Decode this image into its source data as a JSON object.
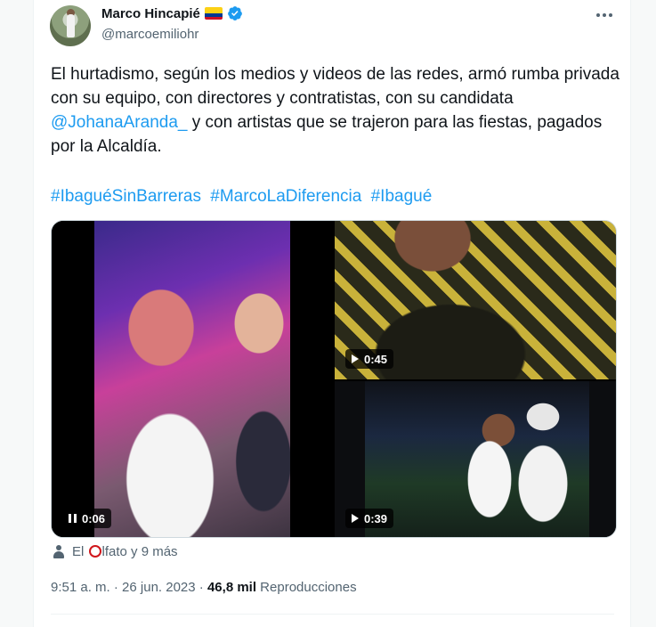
{
  "author": {
    "name": "Marco Hincapié",
    "handle": "@marcoemiliohr"
  },
  "tweet": {
    "text_before_mention": "El hurtadismo, según los medios y videos de las redes, armó rumba privada con su equipo, con directores y contratistas, con su candidata ",
    "mention": "@JohanaAranda_",
    "text_after_mention": " y con artistas que se trajeron para las fiestas, pagados por la Alcaldía.",
    "hashtags": [
      "#IbaguéSinBarreras",
      "#MarcoLaDiferencia",
      "#Ibagué"
    ]
  },
  "media": {
    "videos": [
      {
        "duration": "0:06",
        "state": "playing"
      },
      {
        "duration": "0:45",
        "state": "paused"
      },
      {
        "duration": "0:39",
        "state": "paused"
      }
    ]
  },
  "tagged": {
    "prefix": "El ",
    "suffix": "lfato y 9 más"
  },
  "meta": {
    "time": "9:51 a. m.",
    "sep1": " · ",
    "date": "26 jun. 2023",
    "sep2": " · ",
    "views_count": "46,8 mil",
    "views_label": " Reproducciones"
  },
  "colors": {
    "link": "#1d9bf0",
    "verified": "#1d9bf0",
    "secondary_text": "#536471"
  }
}
